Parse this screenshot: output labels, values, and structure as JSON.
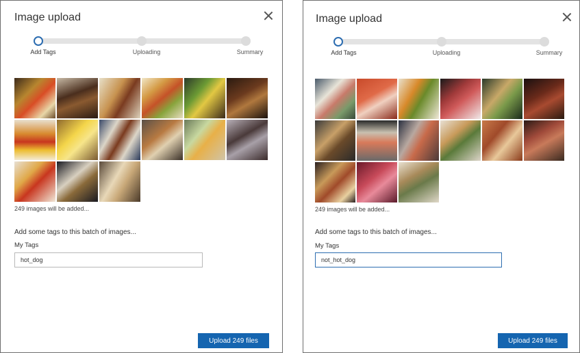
{
  "dialogs": [
    {
      "title": "Image upload",
      "steps": [
        "Add Tags",
        "Uploading",
        "Summary"
      ],
      "count_text": "249 images will be added...",
      "prompt": "Add some tags to this batch of images...",
      "tags_label": "My Tags",
      "tags_value": "hot_dog",
      "upload_label": "Upload 249 files"
    },
    {
      "title": "Image upload",
      "steps": [
        "Add Tags",
        "Uploading",
        "Summary"
      ],
      "count_text": "249 images will be added...",
      "prompt": "Add some tags to this batch of images...",
      "tags_label": "My Tags",
      "tags_value": "not_hot_dog",
      "upload_label": "Upload 249 files"
    }
  ],
  "colors": {
    "accent": "#1565b0",
    "border": "#6d6d6d",
    "track": "#e3e3e3"
  }
}
